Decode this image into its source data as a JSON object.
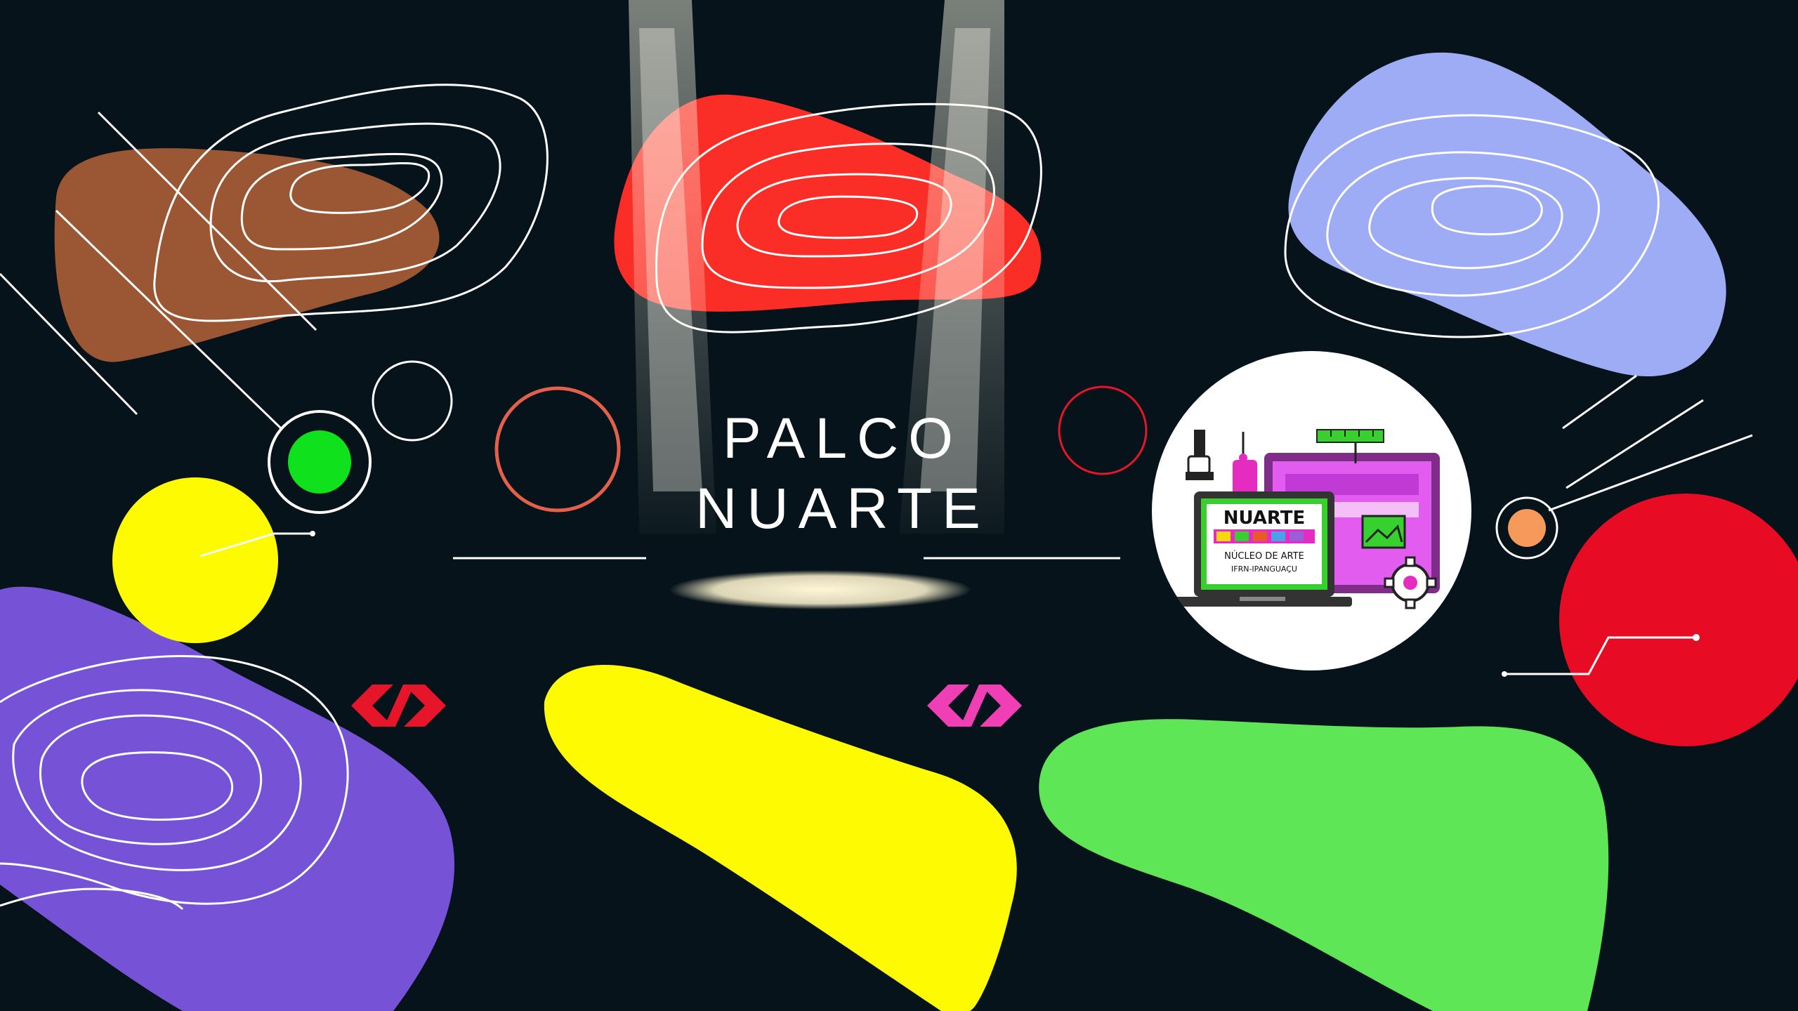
{
  "title": {
    "line1": "PALCO",
    "line2": "NUARTE"
  },
  "logo": {
    "wordmark": "NUARTE",
    "subtitle": "NÚCLEO DE ARTE",
    "institution": "IFRN-IPANGUAÇU"
  },
  "colors": {
    "background": "#06131a",
    "brown": "#9b5633",
    "red": "#fb2d27",
    "lavender": "#9eacf5",
    "purple": "#7652d6",
    "yellow": "#fdfa01",
    "green": "#5ee656",
    "crimson": "#e70c23",
    "accent_green": "#0fe21c",
    "accent_orange": "#f59a5b",
    "magenta": "#f03eb4"
  },
  "icons": [
    "spotlight-icon",
    "code-chevron-icon",
    "gear-icon",
    "image-icon"
  ]
}
